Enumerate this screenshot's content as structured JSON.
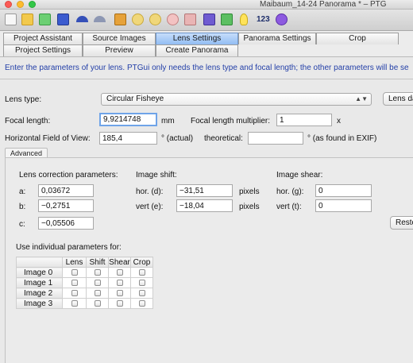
{
  "window": {
    "title": "Maibaum_14-24 Panorama * – PTG"
  },
  "toolbar": {
    "number_badge": "123",
    "icons": [
      "new-document-icon",
      "open-folder-icon",
      "load-images-icon",
      "save-icon",
      "undo-icon",
      "redo-icon",
      "control-points-icon",
      "zoom-in-icon",
      "zoom-out-icon",
      "crosshair-icon",
      "link-icon",
      "panorama-editor-icon",
      "table-grid-icon",
      "lightbulb-icon",
      "number-badge",
      "globe-icon"
    ]
  },
  "tabs_row1": [
    "Project Assistant",
    "Source Images",
    "Lens Settings",
    "Panorama Settings",
    "Crop"
  ],
  "tabs_row2": [
    "Project Settings",
    "Preview",
    "Create Panorama"
  ],
  "instruction": "Enter the parameters of your lens. PTGui only needs the lens type and focal length; the other parameters will be se",
  "lens": {
    "type_label": "Lens type:",
    "type_value": "Circular Fisheye",
    "db_button": "Lens database",
    "focal_label": "Focal length:",
    "focal_value": "9,9214748",
    "focal_unit": "mm",
    "multiplier_label": "Focal length multiplier:",
    "multiplier_value": "1",
    "multiplier_unit": "x",
    "hfov_label": "Horizontal Field of View:",
    "hfov_value": "185,4",
    "hfov_actual": "° (actual)",
    "theoretical_label": "theoretical:",
    "theoretical_value": "",
    "theoretical_note": "° (as found in EXIF)"
  },
  "advanced": {
    "tab_label": "Advanced",
    "correction_title": "Lens correction parameters:",
    "a_label": "a:",
    "a_value": "0,03672",
    "b_label": "b:",
    "b_value": "−0,2751",
    "c_label": "c:",
    "c_value": "−0,05506",
    "shift_title": "Image shift:",
    "hor_label": "hor. (d):",
    "hor_value": "−31,51",
    "hor_unit": "pixels",
    "vert_label": "vert (e):",
    "vert_value": "−18,04",
    "vert_unit": "pixels",
    "shear_title": "Image shear:",
    "shear_hor_label": "hor. (g):",
    "shear_hor_value": "0",
    "shear_vert_label": "vert (t):",
    "shear_vert_value": "0",
    "restore_button": "Restore",
    "individual_label": "Use individual parameters for:",
    "table_columns": [
      "",
      "Lens",
      "Shift",
      "Shear",
      "Crop"
    ],
    "table_rows": [
      {
        "name": "Image 0",
        "checks": [
          false,
          false,
          false,
          false
        ]
      },
      {
        "name": "Image 1",
        "checks": [
          false,
          false,
          false,
          false
        ]
      },
      {
        "name": "Image 2",
        "checks": [
          false,
          false,
          false,
          false
        ]
      },
      {
        "name": "Image 3",
        "checks": [
          false,
          false,
          false,
          false
        ]
      }
    ]
  }
}
